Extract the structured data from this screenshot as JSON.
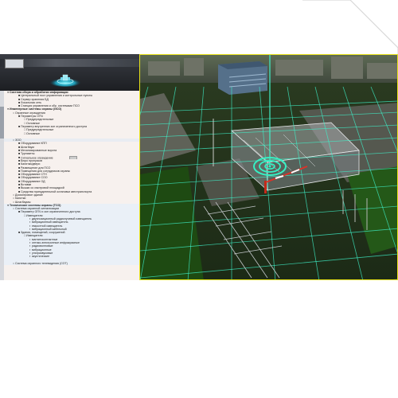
{
  "tree": {
    "rows": [
      {
        "text": "Система сбора и обработки информации",
        "level": 0,
        "bold": true
      },
      {
        "text": "Центральный пост управления и контрольные пункты",
        "level": 2
      },
      {
        "text": "Сервер хранения БД",
        "level": 2
      },
      {
        "text": "Локальная сеть",
        "level": 2
      },
      {
        "text": "Станция управления и обр. системами ПСО",
        "level": 2
      },
      {
        "text": "Инженерные системы охраны (ИСО)",
        "level": 0,
        "bold": true
      },
      {
        "text": "Охранные ограждения",
        "level": 1
      },
      {
        "text": "Периметры ОПЧ",
        "level": 2
      },
      {
        "text": "Предупредительные",
        "level": 3
      },
      {
        "text": "Основные",
        "level": 3
      },
      {
        "text": "Периметр внутренних зон ограниченного доступа",
        "level": 2
      },
      {
        "text": "Предупредительные",
        "level": 3
      },
      {
        "text": "Основные",
        "level": 3
      },
      {
        "text": "",
        "level": 0
      },
      {
        "text": "ЗОО",
        "level": 1,
        "hl": true
      },
      {
        "text": "Оборудование КПП",
        "level": 2
      },
      {
        "text": "Шлагбаум",
        "level": 2
      },
      {
        "text": "Механизированные ворота",
        "level": 2
      },
      {
        "text": "Турникеты",
        "level": 2
      },
      {
        "text": "Сигнальное ограждение",
        "level": 2,
        "btn": true
      },
      {
        "text": "Бюро пропусков",
        "level": 2
      },
      {
        "text": "Калитки/двери",
        "level": 2
      },
      {
        "text": "Размещение для ПСО",
        "level": 2
      },
      {
        "text": "Помещения для сотрудников охраны",
        "level": 2
      },
      {
        "text": "Оборудование СТН",
        "level": 2
      },
      {
        "text": "Оборудование СОО",
        "level": 2
      },
      {
        "text": "Оборудование ОД",
        "level": 2
      },
      {
        "text": "Вставки",
        "level": 2
      },
      {
        "text": "Вышки со смотровой площадкой",
        "level": 2
      },
      {
        "text": "Средства принудительной остановки автотранспорта",
        "level": 2
      },
      {
        "text": "Досмотровое здание",
        "level": 1
      },
      {
        "text": "Калитки",
        "level": 1
      },
      {
        "text": "Шлагбаумы",
        "level": 1
      },
      {
        "text": "Технические системы охраны (ТСО)",
        "level": 0,
        "bold": true
      },
      {
        "text": "Система охранной сигнализации",
        "level": 1
      },
      {
        "text": "Периметр ОПЧ и зон ограниченного доступа",
        "level": 2
      },
      {
        "text": "Извещатели",
        "level": 3
      },
      {
        "text": "двухпозиционный радиолучевой извещатель",
        "level": 4
      },
      {
        "text": "вибрационный извещатель",
        "level": 4
      },
      {
        "text": "емкостной извещатель",
        "level": 4
      },
      {
        "text": "вибрационный кабельный",
        "level": 4
      },
      {
        "text": "Здания, помещений, сооружений",
        "level": 2
      },
      {
        "text": "Извещатели",
        "level": 3
      },
      {
        "text": "магнитоконтактные",
        "level": 4
      },
      {
        "text": "оптико-электронные инфракрасные",
        "level": 4
      },
      {
        "text": "радиоволновые",
        "level": 4
      },
      {
        "text": "вибрационные",
        "level": 4
      },
      {
        "text": "ультразвуковые",
        "level": 4
      },
      {
        "text": "акустические",
        "level": 4
      },
      {
        "text": "",
        "level": 4
      },
      {
        "text": "Система охранного телевидения (СОТ)",
        "level": 1
      }
    ]
  },
  "colors": {
    "accent": "#e8e21a",
    "grid": "#3ff0c8",
    "target": "#35f0c4",
    "header": "#2b2e33"
  },
  "icons": {
    "logo": "app-logo-icon",
    "emblem": "glowing-emblem-icon",
    "target": "target-marker-icon",
    "barrier": "barrier-gate-icon"
  }
}
